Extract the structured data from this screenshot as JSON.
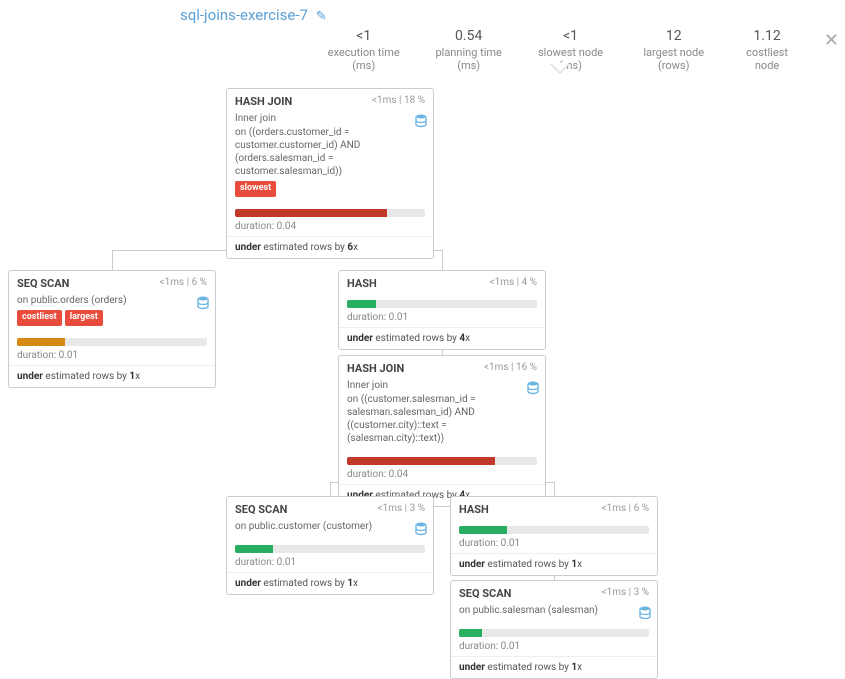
{
  "title": "sql-joins-exercise-7",
  "stats": {
    "exec_val": "<1",
    "exec_lbl": "execution time (ms)",
    "plan_val": "0.54",
    "plan_lbl": "planning time (ms)",
    "slow_val": "<1",
    "slow_lbl": "slowest node (ms)",
    "large_val": "12",
    "large_lbl": "largest node (rows)",
    "cost_val": "1.12",
    "cost_lbl": "costliest node"
  },
  "n1": {
    "title": "HASH JOIN",
    "meta": "<1ms | 18 %",
    "body1": "Inner join",
    "body2": "on ((orders.customer_id = customer.customer_id) AND (orders.salesman_id = customer.salesman_id))",
    "tag1": "slowest",
    "dur": "duration: 0.04",
    "est1": "under",
    "est2": " estimated rows by ",
    "est3": "6",
    "est4": "x"
  },
  "n2": {
    "title": "SEQ SCAN",
    "meta": "<1ms | 6 %",
    "body1": "on public.orders (orders)",
    "tag1": "costliest",
    "tag2": "largest",
    "dur": "duration: 0.01",
    "est1": "under",
    "est2": " estimated rows by ",
    "est3": "1",
    "est4": "x"
  },
  "n3": {
    "title": "HASH",
    "meta": "<1ms | 4 %",
    "dur": "duration: 0.01",
    "est1": "under",
    "est2": " estimated rows by ",
    "est3": "4",
    "est4": "x"
  },
  "n4": {
    "title": "HASH JOIN",
    "meta": "<1ms | 16 %",
    "body1": "Inner join",
    "body2": "on ((customer.salesman_id = salesman.salesman_id) AND ((customer.city)::text = (salesman.city)::text))",
    "dur": "duration: 0.04",
    "est1": "under",
    "est2": " estimated rows by ",
    "est3": "4",
    "est4": "x"
  },
  "n5": {
    "title": "SEQ SCAN",
    "meta": "<1ms | 3 %",
    "body1": "on public.customer (customer)",
    "dur": "duration: 0.01",
    "est1": "under",
    "est2": " estimated rows by ",
    "est3": "1",
    "est4": "x"
  },
  "n6": {
    "title": "HASH",
    "meta": "<1ms | 6 %",
    "dur": "duration: 0.01",
    "est1": "under",
    "est2": " estimated rows by ",
    "est3": "1",
    "est4": "x"
  },
  "n7": {
    "title": "SEQ SCAN",
    "meta": "<1ms | 3 %",
    "body1": "on public.salesman (salesman)",
    "dur": "duration: 0.01",
    "est1": "under",
    "est2": " estimated rows by ",
    "est3": "1",
    "est4": "x"
  }
}
